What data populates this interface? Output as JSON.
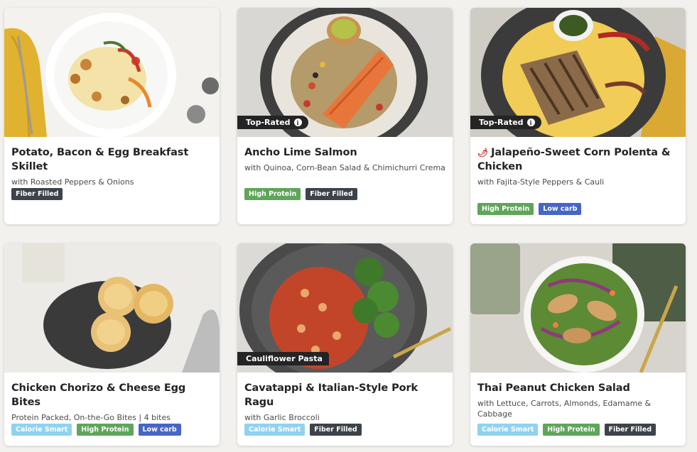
{
  "colors": {
    "background": "#f2f1ee",
    "card": "#ffffff",
    "tag_bg": "#242424",
    "badge_fiber": "#3d434a",
    "badge_protein": "#5fa55a",
    "badge_lowcarb": "#4665c7",
    "badge_calorie": "#8fd3f0"
  },
  "cards": [
    {
      "title": "Potato, Bacon & Egg Breakfast Skillet",
      "subtitle": "with Roasted Peppers & Onions",
      "tag": "",
      "spicy": false,
      "badges": [
        "Fiber Filled"
      ]
    },
    {
      "title": "Ancho Lime Salmon",
      "subtitle": "with Quinoa, Corn-Bean Salad & Chimichurri Crema",
      "tag": "Top-Rated",
      "spicy": false,
      "badges": [
        "High Protein",
        "Fiber Filled"
      ]
    },
    {
      "title": "Jalapeño-Sweet Corn Polenta & Chicken",
      "subtitle": "with Fajita-Style Peppers & Cauli",
      "tag": "Top-Rated",
      "spicy": true,
      "badges": [
        "High Protein",
        "Low carb"
      ]
    },
    {
      "title": "Chicken Chorizo & Cheese Egg Bites",
      "subtitle": "Protein Packed, On-the-Go Bites | 4 bites",
      "tag": "",
      "spicy": false,
      "badges": [
        "Calorie Smart",
        "High Protein",
        "Low carb"
      ]
    },
    {
      "title": "Cavatappi & Italian-Style Pork Ragu",
      "subtitle": "with Garlic Broccoli",
      "tag": "Cauliflower Pasta",
      "spicy": false,
      "badges": [
        "Calorie Smart",
        "Fiber Filled"
      ]
    },
    {
      "title": "Thai Peanut Chicken Salad",
      "subtitle": "with Lettuce, Carrots, Almonds, Edamame & Cabbage",
      "tag": "",
      "spicy": false,
      "badges": [
        "Calorie Smart",
        "High Protein",
        "Fiber Filled"
      ]
    }
  ]
}
